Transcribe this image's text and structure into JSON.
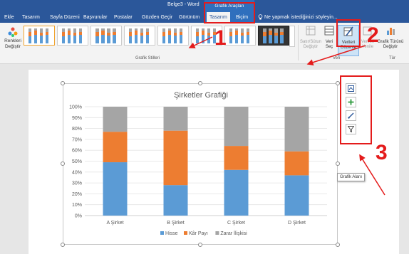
{
  "window": {
    "title": "Belge3 - Word",
    "context_group": "Grafik Araçları"
  },
  "tabs": [
    {
      "label": "Ekle",
      "active": false
    },
    {
      "label": "Tasarım",
      "active": false
    },
    {
      "label": "Sayfa Düzeni",
      "active": false
    },
    {
      "label": "Başvurular",
      "active": false
    },
    {
      "label": "Postalar",
      "active": false
    },
    {
      "label": "Gözden Geçir",
      "active": false
    },
    {
      "label": "Görünüm",
      "active": false
    },
    {
      "label": "Tasarım",
      "active": true
    },
    {
      "label": "Biçim",
      "active": false
    }
  ],
  "tell_me": {
    "text": "Ne yapmak istediğinizi söyleyin..."
  },
  "ribbon": {
    "colors_btn": {
      "line1": "Renkleri",
      "line2": "Değiştir"
    },
    "styles_group_label": "Grafik Stilleri",
    "switch_row_col": {
      "line1": "Satır/Sütun",
      "line2": "Değiştir"
    },
    "select_data": {
      "line1": "Veri",
      "line2": "Seç"
    },
    "edit_data": {
      "line1": "Verileri",
      "line2": "Düzenle"
    },
    "refresh_data": {
      "line1": "Verileri",
      "line2": "Yenile"
    },
    "change_type": {
      "line1": "Grafik Türünü",
      "line2": "Değiştir"
    },
    "data_group_label": "Veri",
    "type_group_label": "Tür"
  },
  "tooltip": {
    "text": "Grafik Alanı"
  },
  "annotations": {
    "n1": "1",
    "n2": "2",
    "n3": "3",
    "color": "#e41b1b"
  },
  "chart_data": {
    "type": "bar",
    "stacked": "percent",
    "title": "Şirketler Grafiği",
    "categories": [
      "A Şirket",
      "B Şirket",
      "C Şirket",
      "D Şirket"
    ],
    "series": [
      {
        "name": "Hisse",
        "color": "#5b9bd5",
        "values": [
          49,
          28,
          42,
          37
        ]
      },
      {
        "name": "Kâr Payı",
        "color": "#ed7d31",
        "values": [
          28,
          50,
          22,
          22
        ]
      },
      {
        "name": "Zarar İlişkisi",
        "color": "#a5a5a5",
        "values": [
          23,
          22,
          36,
          41
        ]
      }
    ],
    "y_ticks": [
      "0%",
      "10%",
      "20%",
      "30%",
      "40%",
      "50%",
      "60%",
      "70%",
      "80%",
      "90%",
      "100%"
    ],
    "ylim": [
      0,
      100
    ],
    "grid": true,
    "legend": "bottom"
  }
}
